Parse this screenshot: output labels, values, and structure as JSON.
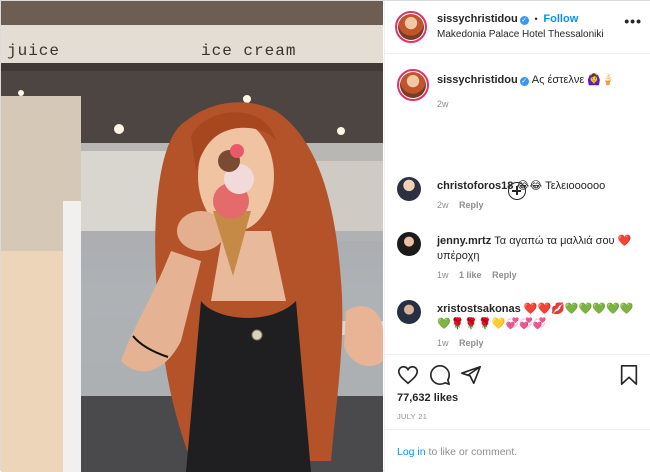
{
  "photo": {
    "sign_left": "juice",
    "sign_right": "ice cream"
  },
  "header": {
    "username": "sissychristidou",
    "verified": "✓",
    "separator": "•",
    "follow": "Follow",
    "location": "Makedonia Palace Hotel Thessaloniki",
    "more": "•••"
  },
  "caption": {
    "username": "sissychristidou",
    "verified": "✓",
    "text": "Ας έστελνε 🙆‍♀️🍦",
    "age": "2w"
  },
  "comments": [
    {
      "username": "christoforos18",
      "text": "😂😂 Τελειοοοοοο",
      "age": "2w",
      "likes": "",
      "reply": "Reply"
    },
    {
      "username": "jenny.mrtz",
      "text": "Τα αγαπώ τα μαλλιά σου ❤️ υπέροχη",
      "age": "1w",
      "likes": "1 like",
      "reply": "Reply"
    },
    {
      "username": "xristostsakonas",
      "text": "❤️❤️💋💚💚💚💚💚💚🌹🌹🌹💛💞💞💞",
      "age": "1w",
      "likes": "",
      "reply": "Reply"
    }
  ],
  "stats": {
    "likes": "77,632 likes",
    "date": "JULY 21"
  },
  "login": {
    "link": "Log in",
    "rest": " to like or comment."
  },
  "colors": {
    "accent": "#0095f6",
    "verified": "#3897f0",
    "text": "#262626",
    "muted": "#8e8e8e",
    "border": "#dbdbdb"
  },
  "icons": [
    "heart-icon",
    "comment-icon",
    "share-icon",
    "bookmark-icon",
    "more-icon",
    "load-more-icon",
    "verified-icon"
  ]
}
